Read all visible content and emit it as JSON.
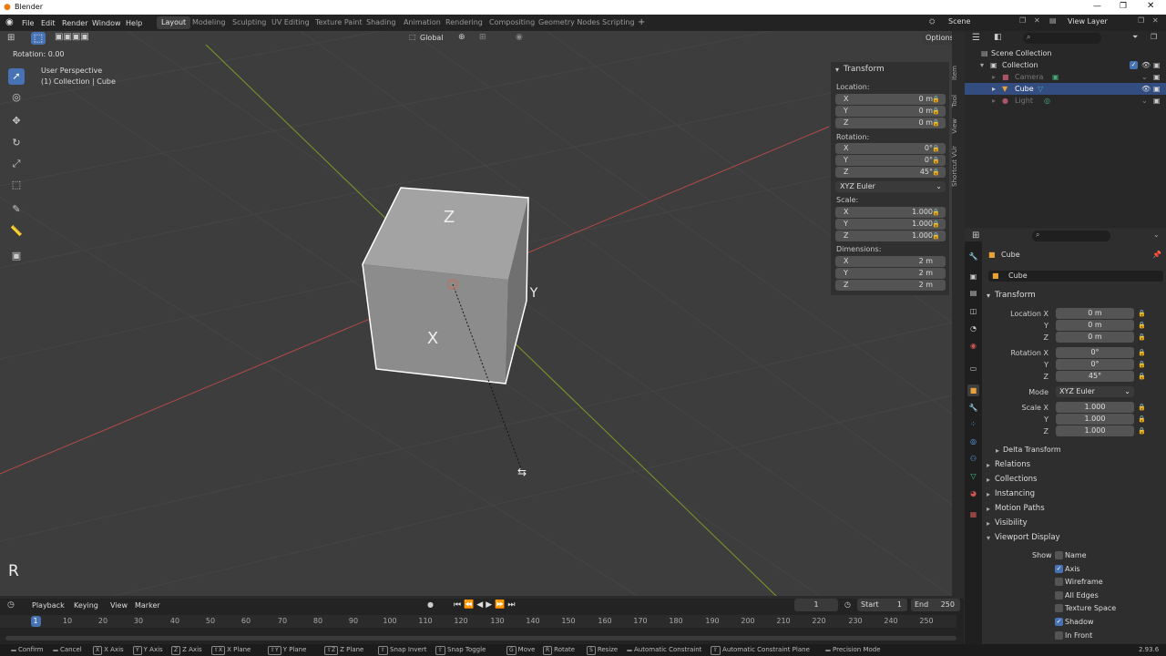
{
  "app": {
    "title": "Blender",
    "version": "2.93.6"
  },
  "menu": [
    "File",
    "Edit",
    "Render",
    "Window",
    "Help"
  ],
  "workspaces": [
    "Layout",
    "Modeling",
    "Sculpting",
    "UV Editing",
    "Texture Paint",
    "Shading",
    "Animation",
    "Rendering",
    "Compositing",
    "Geometry Nodes",
    "Scripting"
  ],
  "active_workspace": "Layout",
  "scene": {
    "name": "Scene",
    "view_layer": "View Layer"
  },
  "viewport": {
    "orientation": "Global",
    "options_label": "Options",
    "operator_text": "Rotation: 0.00",
    "perspective": "User Perspective",
    "collection_path": "(1) Collection | Cube",
    "key_hint": "R",
    "axis_labels": [
      "Z",
      "X",
      "Y"
    ]
  },
  "npanel": {
    "header": "Transform",
    "tabs": [
      "Item",
      "Tool",
      "View",
      "Shortcut VUr"
    ],
    "location_label": "Location:",
    "location": [
      {
        "axis": "X",
        "value": "0 m"
      },
      {
        "axis": "Y",
        "value": "0 m"
      },
      {
        "axis": "Z",
        "value": "0 m"
      }
    ],
    "rotation_label": "Rotation:",
    "rotation": [
      {
        "axis": "X",
        "value": "0°"
      },
      {
        "axis": "Y",
        "value": "0°"
      },
      {
        "axis": "Z",
        "value": "45°"
      }
    ],
    "rotation_mode": "XYZ Euler",
    "scale_label": "Scale:",
    "scale": [
      {
        "axis": "X",
        "value": "1.000"
      },
      {
        "axis": "Y",
        "value": "1.000"
      },
      {
        "axis": "Z",
        "value": "1.000"
      }
    ],
    "dimensions_label": "Dimensions:",
    "dimensions": [
      {
        "axis": "X",
        "value": "2 m"
      },
      {
        "axis": "Y",
        "value": "2 m"
      },
      {
        "axis": "Z",
        "value": "2 m"
      }
    ]
  },
  "outliner": {
    "root": "Scene Collection",
    "collection": "Collection",
    "items": [
      "Camera",
      "Cube",
      "Light"
    ],
    "selected": "Cube"
  },
  "properties": {
    "object_name": "Cube",
    "object_field": "Cube",
    "transform_header": "Transform",
    "location_labels": [
      "Location X",
      "Y",
      "Z"
    ],
    "location_values": [
      "0 m",
      "0 m",
      "0 m"
    ],
    "rotation_labels": [
      "Rotation X",
      "Y",
      "Z"
    ],
    "rotation_values": [
      "0°",
      "0°",
      "45°"
    ],
    "mode_label": "Mode",
    "mode_value": "XYZ Euler",
    "scale_labels": [
      "Scale X",
      "Y",
      "Z"
    ],
    "scale_values": [
      "1.000",
      "1.000",
      "1.000"
    ],
    "delta_transform": "Delta Transform",
    "sections": [
      "Relations",
      "Collections",
      "Instancing",
      "Motion Paths",
      "Visibility",
      "Viewport Display"
    ],
    "show_label": "Show",
    "show_options": [
      {
        "label": "Name",
        "checked": false
      },
      {
        "label": "Axis",
        "checked": true
      },
      {
        "label": "Wireframe",
        "checked": false
      },
      {
        "label": "All Edges",
        "checked": false
      },
      {
        "label": "Texture Space",
        "checked": false
      },
      {
        "label": "Shadow",
        "checked": true
      },
      {
        "label": "In Front",
        "checked": false
      }
    ]
  },
  "timeline": {
    "menus": [
      "Playback",
      "Keying",
      "View",
      "Marker"
    ],
    "current_frame": "1",
    "start_label": "Start",
    "start": "1",
    "end_label": "End",
    "end": "250",
    "ticks": [
      "1",
      "10",
      "20",
      "30",
      "40",
      "50",
      "60",
      "70",
      "80",
      "90",
      "100",
      "110",
      "120",
      "130",
      "140",
      "150",
      "160",
      "170",
      "180",
      "190",
      "200",
      "210",
      "220",
      "230",
      "240",
      "250"
    ]
  },
  "statusbar": [
    {
      "key": "",
      "label": "Confirm"
    },
    {
      "key": "",
      "label": "Cancel"
    },
    {
      "key": "X",
      "label": "X Axis"
    },
    {
      "key": "Y",
      "label": "Y Axis"
    },
    {
      "key": "Z",
      "label": "Z Axis"
    },
    {
      "key": "⇧X",
      "label": "X Plane"
    },
    {
      "key": "⇧Y",
      "label": "Y Plane"
    },
    {
      "key": "⇧Z",
      "label": "Z Plane"
    },
    {
      "key": "⇧",
      "label": "Snap Invert"
    },
    {
      "key": "⇧",
      "label": "Snap Toggle"
    },
    {
      "key": "G",
      "label": "Move"
    },
    {
      "key": "R",
      "label": "Rotate"
    },
    {
      "key": "S",
      "label": "Resize"
    },
    {
      "key": "",
      "label": "Automatic Constraint"
    },
    {
      "key": "⇧",
      "label": "Automatic Constraint Plane"
    },
    {
      "key": "",
      "label": "Precision Mode"
    }
  ],
  "colors": {
    "accent": "#4772b3",
    "x_axis": "#b34a4a",
    "y_axis": "#7a9a2a",
    "selected_row": "#334d80"
  }
}
